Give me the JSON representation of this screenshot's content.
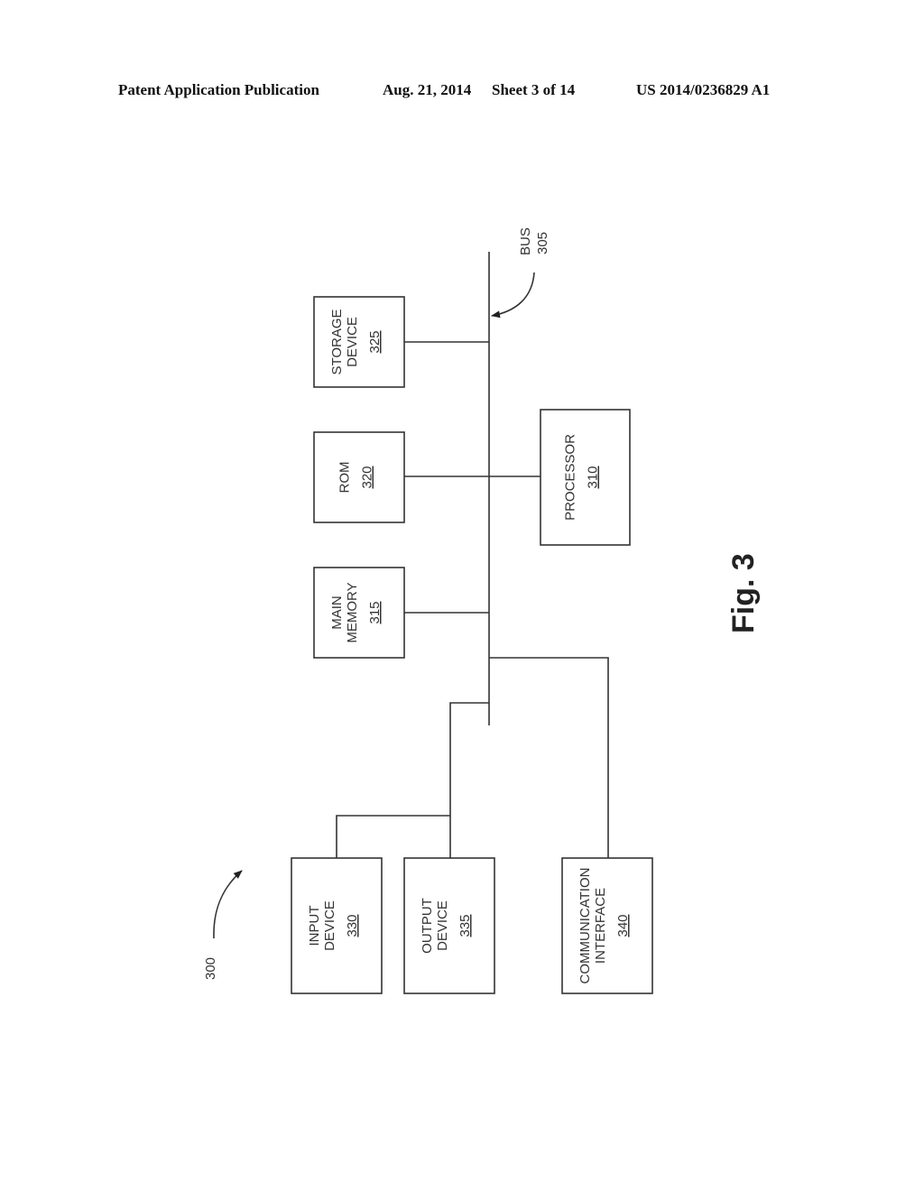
{
  "header": {
    "publication": "Patent Application Publication",
    "date": "Aug. 21, 2014",
    "sheet": "Sheet 3 of 14",
    "number": "US 2014/0236829 A1"
  },
  "figure": {
    "label": "Fig. 3",
    "system_ref": "300",
    "bus": {
      "name": "BUS",
      "ref": "305"
    },
    "blocks": [
      {
        "id": "storage",
        "lines": [
          "STORAGE",
          "DEVICE"
        ],
        "ref": "325"
      },
      {
        "id": "rom",
        "lines": [
          "ROM"
        ],
        "ref": "320"
      },
      {
        "id": "main-memory",
        "lines": [
          "MAIN",
          "MEMORY"
        ],
        "ref": "315"
      },
      {
        "id": "processor",
        "lines": [
          "PROCESSOR"
        ],
        "ref": "310"
      },
      {
        "id": "input",
        "lines": [
          "INPUT",
          "DEVICE"
        ],
        "ref": "330"
      },
      {
        "id": "output",
        "lines": [
          "OUTPUT",
          "DEVICE"
        ],
        "ref": "335"
      },
      {
        "id": "comm",
        "lines": [
          "COMMUNICATION",
          "INTERFACE"
        ],
        "ref": "340"
      }
    ]
  }
}
